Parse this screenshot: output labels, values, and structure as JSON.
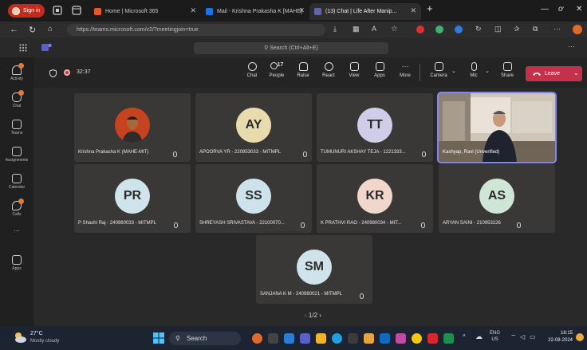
{
  "browser": {
    "signin_label": "Sign in",
    "tabs": [
      {
        "label": "Home | Microsoft 365",
        "favicon_color": "#e8592a"
      },
      {
        "label": "Mail - Krishna Prakasha K [MAHE]",
        "favicon_color": "#1a73e8"
      },
      {
        "label": "(13) Chat | Life After Manip...",
        "favicon_color": "#6264a7"
      }
    ],
    "url": "https://teams.microsoft.com/v2/?meetingjoin=true"
  },
  "teams": {
    "search_placeholder": "Search (Ctrl+Alt+E)"
  },
  "rail": [
    {
      "label": "Activity",
      "icon": "bell-icon",
      "badge": true
    },
    {
      "label": "Chat",
      "icon": "chat-icon",
      "badge": true
    },
    {
      "label": "Teams",
      "icon": "teams-icon",
      "badge": false
    },
    {
      "label": "Assignments",
      "icon": "assignments-icon",
      "badge": false
    },
    {
      "label": "Calendar",
      "icon": "calendar-icon",
      "badge": false
    },
    {
      "label": "Calls",
      "icon": "phone-icon",
      "badge": false
    },
    {
      "label": "...",
      "icon": "more-icon",
      "badge": false
    },
    {
      "label": "Apps",
      "icon": "apps-icon",
      "badge": false
    }
  ],
  "meeting": {
    "timer": "32:37",
    "people_count": "17",
    "tools": {
      "chat": "Chat",
      "people": "People",
      "raise": "Raise",
      "react": "React",
      "view": "View",
      "apps": "Apps",
      "more": "More",
      "camera": "Camera",
      "mic": "Mic",
      "share": "Share"
    },
    "leave_label": "Leave",
    "pager": "1/2",
    "participants": [
      {
        "name": "Krishna Prakasha K (MAHE-MIT)",
        "initials": "",
        "avatar_color": "#c7421e"
      },
      {
        "name": "APOORVA YR - 220953033 - MITMPL",
        "initials": "AY",
        "avatar_color": "#e8dcae"
      },
      {
        "name": "TUMUNURI AKSHAY TEJA - 1221333...",
        "initials": "TT",
        "avatar_color": "#d0cde8"
      },
      {
        "name": "Kashyap, Ravi (Unverified)",
        "initials": "",
        "avatar_color": "#8a7a6a"
      },
      {
        "name": "P Shashi Raj - 240980033 - MITMPL",
        "initials": "PR",
        "avatar_color": "#cfe3ea"
      },
      {
        "name": "SHREYASH SRIVASTAVA - 22100070...",
        "initials": "SS",
        "avatar_color": "#cde2ea"
      },
      {
        "name": "K PRATHVI RAO - 240980034 - MIT...",
        "initials": "KR",
        "avatar_color": "#f0d6cb"
      },
      {
        "name": "ARYAN SAINI - 210953226",
        "initials": "AS",
        "avatar_color": "#cfe6d6"
      },
      {
        "name": "SANJANA K M - 240980021 - MITMPL",
        "initials": "SM",
        "avatar_color": "#cfe3ea"
      }
    ]
  },
  "taskbar": {
    "weather_temp": "27°C",
    "weather_desc": "Mostly cloudy",
    "search_label": "Search",
    "lang_top": "ENG",
    "lang_bottom": "US",
    "time": "18:15",
    "date": "22-08-2024"
  }
}
